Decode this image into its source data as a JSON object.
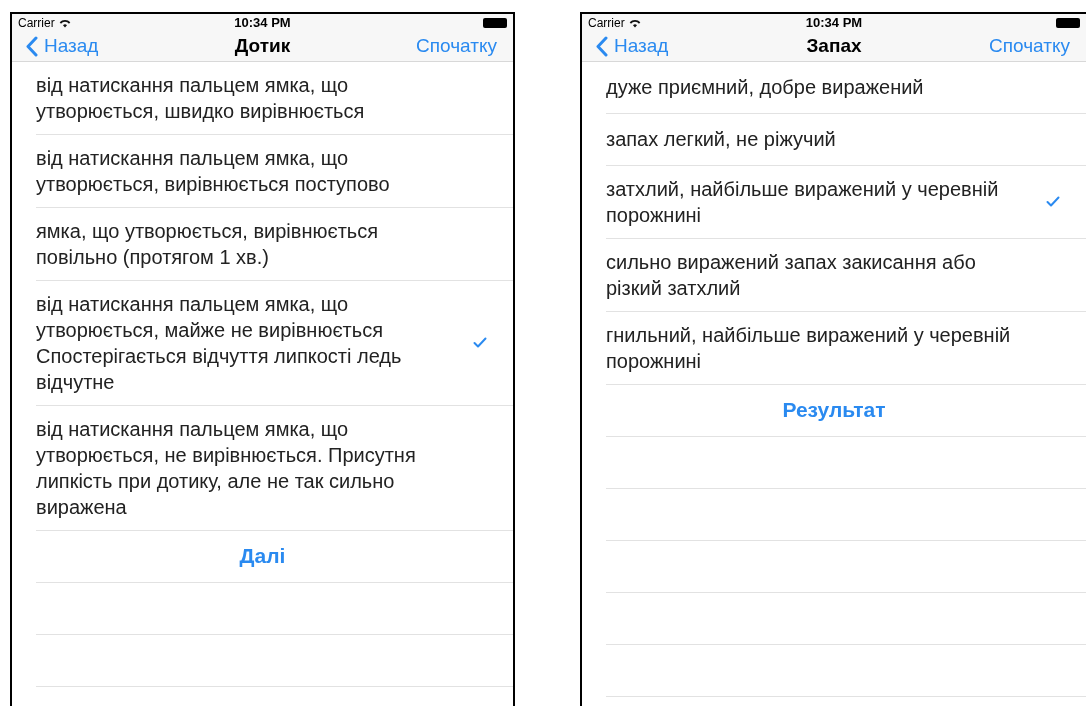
{
  "phones": [
    {
      "status": {
        "carrier": "Carrier",
        "time": "10:34 PM"
      },
      "nav": {
        "back": "Назад",
        "title": "Дотик",
        "action": "Спочатку"
      },
      "options": [
        {
          "text": "від натискання пальцем ямка, що утворюється, швидко вирівнюється",
          "selected": false
        },
        {
          "text": "від натискання пальцем ямка, що утворюється, вирівнюється поступово",
          "selected": false
        },
        {
          "text": "ямка, що утворюється, вирівнюється повільно (протягом 1 хв.)",
          "selected": false
        },
        {
          "text": "від натискання пальцем ямка, що утворюється, майже не вирівнюється Спостерігається відчуття липкості ледь відчутне",
          "selected": true
        },
        {
          "text": "від натискання пальцем ямка, що утворюється, не вирівнюється. Присутня липкість при дотику, але не так сильно виражена",
          "selected": false
        }
      ],
      "button": "Далі"
    },
    {
      "status": {
        "carrier": "Carrier",
        "time": "10:34 PM"
      },
      "nav": {
        "back": "Назад",
        "title": "Запах",
        "action": "Спочатку"
      },
      "options": [
        {
          "text": "дуже приємний, добре виражений",
          "selected": false
        },
        {
          "text": "запах легкий, не ріжучий",
          "selected": false
        },
        {
          "text": "затхлий, найбільше виражений у черевній порожнині",
          "selected": true
        },
        {
          "text": "сильно виражений запах закисання або різкий затхлий",
          "selected": false
        },
        {
          "text": "гнильний, найбільше виражений у черевній порожнині",
          "selected": false
        }
      ],
      "button": "Результат"
    }
  ]
}
